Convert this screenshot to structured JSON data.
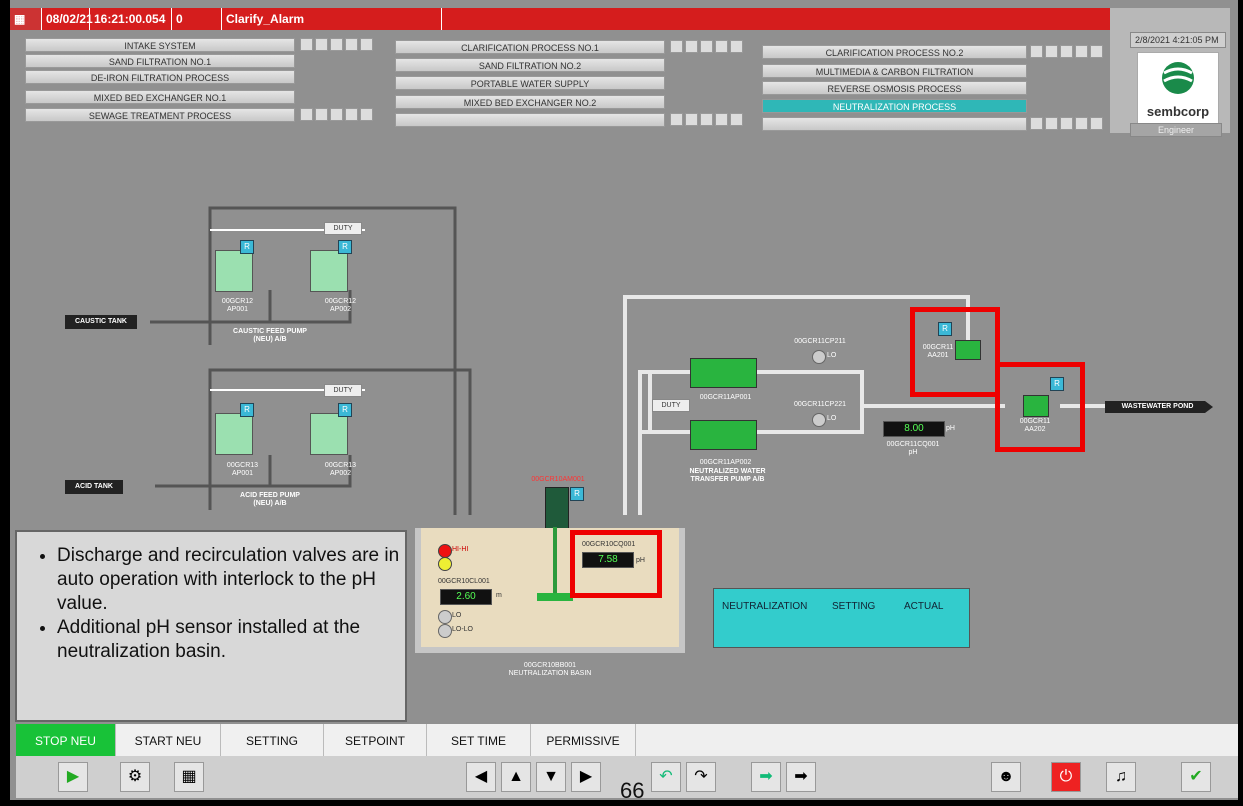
{
  "alarm_bar": {
    "date": "08/02/21",
    "time": "16:21:00.054",
    "count": "0",
    "alarm_name": "Clarify_Alarm"
  },
  "status": {
    "datetime": "2/8/2021 4:21:05 PM",
    "user": "Engineer",
    "logo": "sembcorp"
  },
  "nav": {
    "col1": [
      "INTAKE SYSTEM",
      "SAND FILTRATION NO.1",
      "DE-IRON FILTRATION PROCESS",
      "MIXED BED EXCHANGER NO.1",
      "SEWAGE TREATMENT PROCESS"
    ],
    "col2": [
      "CLARIFICATION PROCESS NO.1",
      "SAND FILTRATION NO.2",
      "PORTABLE WATER SUPPLY",
      "MIXED BED EXCHANGER NO.2",
      ""
    ],
    "col3": [
      "CLARIFICATION PROCESS NO.2",
      "MULTIMEDIA & CARBON FILTRATION",
      "REVERSE OSMOSIS PROCESS",
      "NEUTRALIZATION PROCESS",
      ""
    ]
  },
  "process": {
    "caustic_tank": "CAUSTIC TANK",
    "acid_tank": "ACID TANK",
    "duty": "DUTY",
    "r": "R",
    "caustic_pump_a": [
      "00GCR12",
      "AP001"
    ],
    "caustic_pump_b": [
      "00GCR12",
      "AP002"
    ],
    "caustic_feed_pump": [
      "CAUSTIC FEED PUMP",
      "(NEU) A/B"
    ],
    "acid_pump_a": [
      "00GCR13",
      "AP001"
    ],
    "acid_pump_b": [
      "00GCR13",
      "AP002"
    ],
    "acid_feed_pump": [
      "ACID FEED PUMP",
      "(NEU) A/B"
    ],
    "transfer_pump_a": "00GCR11AP001",
    "transfer_pump_b": "00GCR11AP002",
    "transfer_pump_label": [
      "NEUTRALIZED WATER",
      "TRANSFER PUMP A/B"
    ],
    "cp211": "00GCR11CP211",
    "cp221": "00GCR11CP221",
    "lo": "LO",
    "valve_aa201": [
      "00GCR11",
      "AA201"
    ],
    "valve_aa202": [
      "00GCR11",
      "AA202"
    ],
    "ph_outlet_value": "8.00",
    "ph_unit": "pH",
    "ph_outlet_tag": [
      "00GCR11CQ001",
      "pH"
    ],
    "wastewater_pond": "WASTEWATER POND",
    "agitator_tag": "00GCR10AM001",
    "basin_ph_tag": "00GCR10CQ001",
    "basin_ph_value": "7.58",
    "basin_level_tag": "00GCR10CL001",
    "basin_level_value": "2.60",
    "level_unit": "m",
    "hi_hi": "HI-HI",
    "lo_lo": "LO-LO",
    "basin_tag": [
      "00GCR10BB001",
      "NEUTRALIZATION BASIN"
    ],
    "neu_panel": {
      "title": "NEUTRALIZATION",
      "setting": "SETTING",
      "actual": "ACTUAL"
    }
  },
  "note": {
    "bullets": [
      "Discharge and recirculation valves are in auto operation with interlock to the pH value.",
      "Additional pH sensor installed at the neutralization basin."
    ]
  },
  "tabs": [
    "STOP NEU",
    "START NEU",
    "SETTING",
    "SETPOINT",
    "SET TIME",
    "PERMISSIVE"
  ],
  "page_number": "66"
}
